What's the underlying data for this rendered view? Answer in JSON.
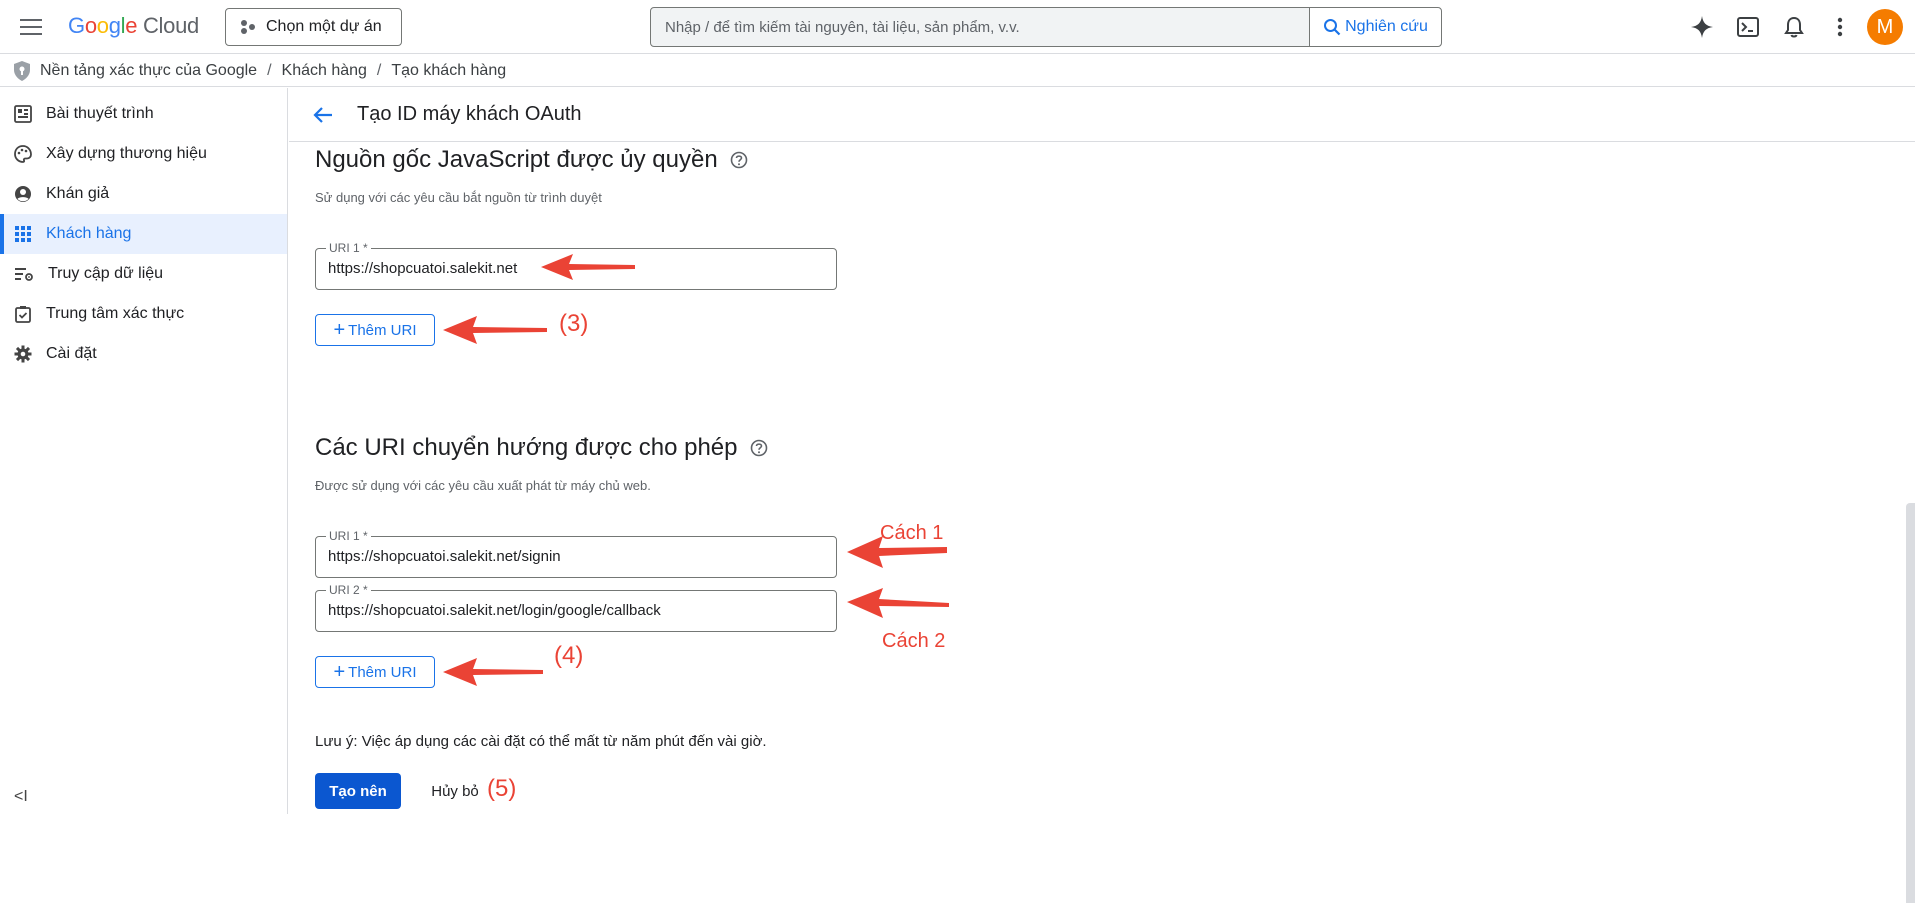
{
  "header": {
    "logo_google": "Google",
    "logo_cloud": " Cloud",
    "project_label": "Chọn một dự án",
    "search_placeholder": "Nhập / để tìm kiếm tài nguyên, tài liệu, sản phẩm, v.v.",
    "search_button": "Nghiên cứu",
    "avatar_letter": "M"
  },
  "breadcrumb": {
    "items": [
      "Nền tảng xác thực của Google",
      "Khách hàng",
      "Tạo khách hàng"
    ],
    "separator": "/"
  },
  "sidebar": {
    "items": [
      {
        "label": "Bài thuyết trình",
        "icon": "dashboard-icon"
      },
      {
        "label": "Xây dựng thương hiệu",
        "icon": "palette-icon"
      },
      {
        "label": "Khán giả",
        "icon": "account-circle-icon"
      },
      {
        "label": "Khách hàng",
        "icon": "apps-grid-icon",
        "active": true
      },
      {
        "label": "Truy cập dữ liệu",
        "icon": "data-access-icon"
      },
      {
        "label": "Trung tâm xác thực",
        "icon": "verified-icon"
      },
      {
        "label": "Cài đặt",
        "icon": "gear-icon"
      }
    ],
    "collapse_label": "<I"
  },
  "page": {
    "title": "Tạo ID máy khách OAuth",
    "js_origins": {
      "title": "Nguồn gốc JavaScript được ủy quyền",
      "description": "Sử dụng với các yêu cầu bắt nguồn từ trình duyệt",
      "uris": [
        {
          "label": "URI 1 *",
          "value": "https://shopcuatoi.salekit.net"
        }
      ],
      "add_button": "Thêm URI"
    },
    "redirect_uris": {
      "title": "Các URI chuyển hướng được cho phép",
      "description": "Được sử dụng với các yêu cầu xuất phát từ máy chủ web.",
      "uris": [
        {
          "label": "URI 1 *",
          "value": "https://shopcuatoi.salekit.net/signin"
        },
        {
          "label": "URI 2 *",
          "value": "https://shopcuatoi.salekit.net/login/google/callback"
        }
      ],
      "add_button": "Thêm URI"
    },
    "note": "Lưu ý: Việc áp dụng các cài đặt có thể mất từ năm phút đến vài giờ.",
    "create_button": "Tạo nên",
    "cancel_button": "Hủy bỏ"
  },
  "annotations": {
    "step3": "(3)",
    "step4": "(4)",
    "step5": "(5)",
    "way1": "Cách 1",
    "way2": "Cách 2"
  },
  "colors": {
    "accent": "#1a73e8",
    "primary_button": "#0b57d0",
    "annotation": "#ea4335"
  }
}
